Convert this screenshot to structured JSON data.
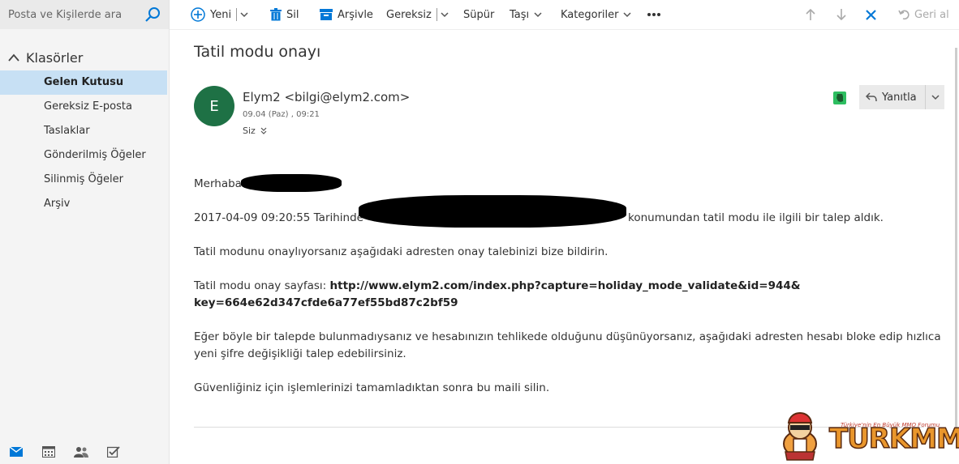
{
  "search": {
    "placeholder": "Posta ve Kişilerde ara"
  },
  "folders": {
    "header": "Klasörler",
    "items": [
      {
        "label": "Gelen Kutusu",
        "active": true
      },
      {
        "label": "Gereksiz E-posta"
      },
      {
        "label": "Taslaklar"
      },
      {
        "label": "Gönderilmiş Öğeler"
      },
      {
        "label": "Silinmiş Öğeler"
      },
      {
        "label": "Arşiv"
      }
    ]
  },
  "bottom_nav": [
    "mail-icon",
    "calendar-icon",
    "people-icon",
    "tasks-icon"
  ],
  "toolbar": {
    "new_label": "Yeni",
    "delete_label": "Sil",
    "archive_label": "Arşivle",
    "junk_label": "Gereksiz",
    "sweep_label": "Süpür",
    "move_label": "Taşı",
    "categories_label": "Kategoriler",
    "undo_label": "Geri al"
  },
  "message": {
    "subject": "Tatil modu onayı",
    "avatar_letter": "E",
    "sender": "Elym2 <bilgi@elym2.com>",
    "date": "09.04 (Paz) , 09:21",
    "to": "Siz",
    "reply_label": "Yanıtla",
    "body": {
      "greeting": "Merhaba",
      "line1_prefix": "2017-04-09 09:20:55 Tarihinde",
      "line1_suffix": "konumundan tatil modu ile ilgili bir talep aldık.",
      "line2": "Tatil modunu onaylıyorsanız aşağıdaki adresten onay talebinizi bize bildirin.",
      "line3_prefix": "Tatil modu onay sayfası:",
      "link_line1": "http://www.elym2.com/index.php?capture=holiday_mode_validate&id=944&",
      "link_line2": "key=664e62d347cfde6a77ef55bd87c2bf59",
      "line4a": "Eğer böyle bir talepde bulunmadıysanız ve hesabınızın tehlikede olduğunu düşünüyorsanız, aşağıdaki adresten hesabı bloke edip hızlıca",
      "line4b": "yeni şifre değişikliği talep edebilirsiniz.",
      "line5": "Güvenliğiniz için işlemlerinizi tamamladıktan sonra bu maili silin."
    }
  },
  "watermark": {
    "text": "TURKMMO",
    "tagline": "Türkiye'nin En Büyük MMO Forumu"
  },
  "colors": {
    "accent": "#0078d7",
    "avatar": "#1e7145",
    "active_folder": "#c7e0f4",
    "close_x": "#0078d7"
  }
}
